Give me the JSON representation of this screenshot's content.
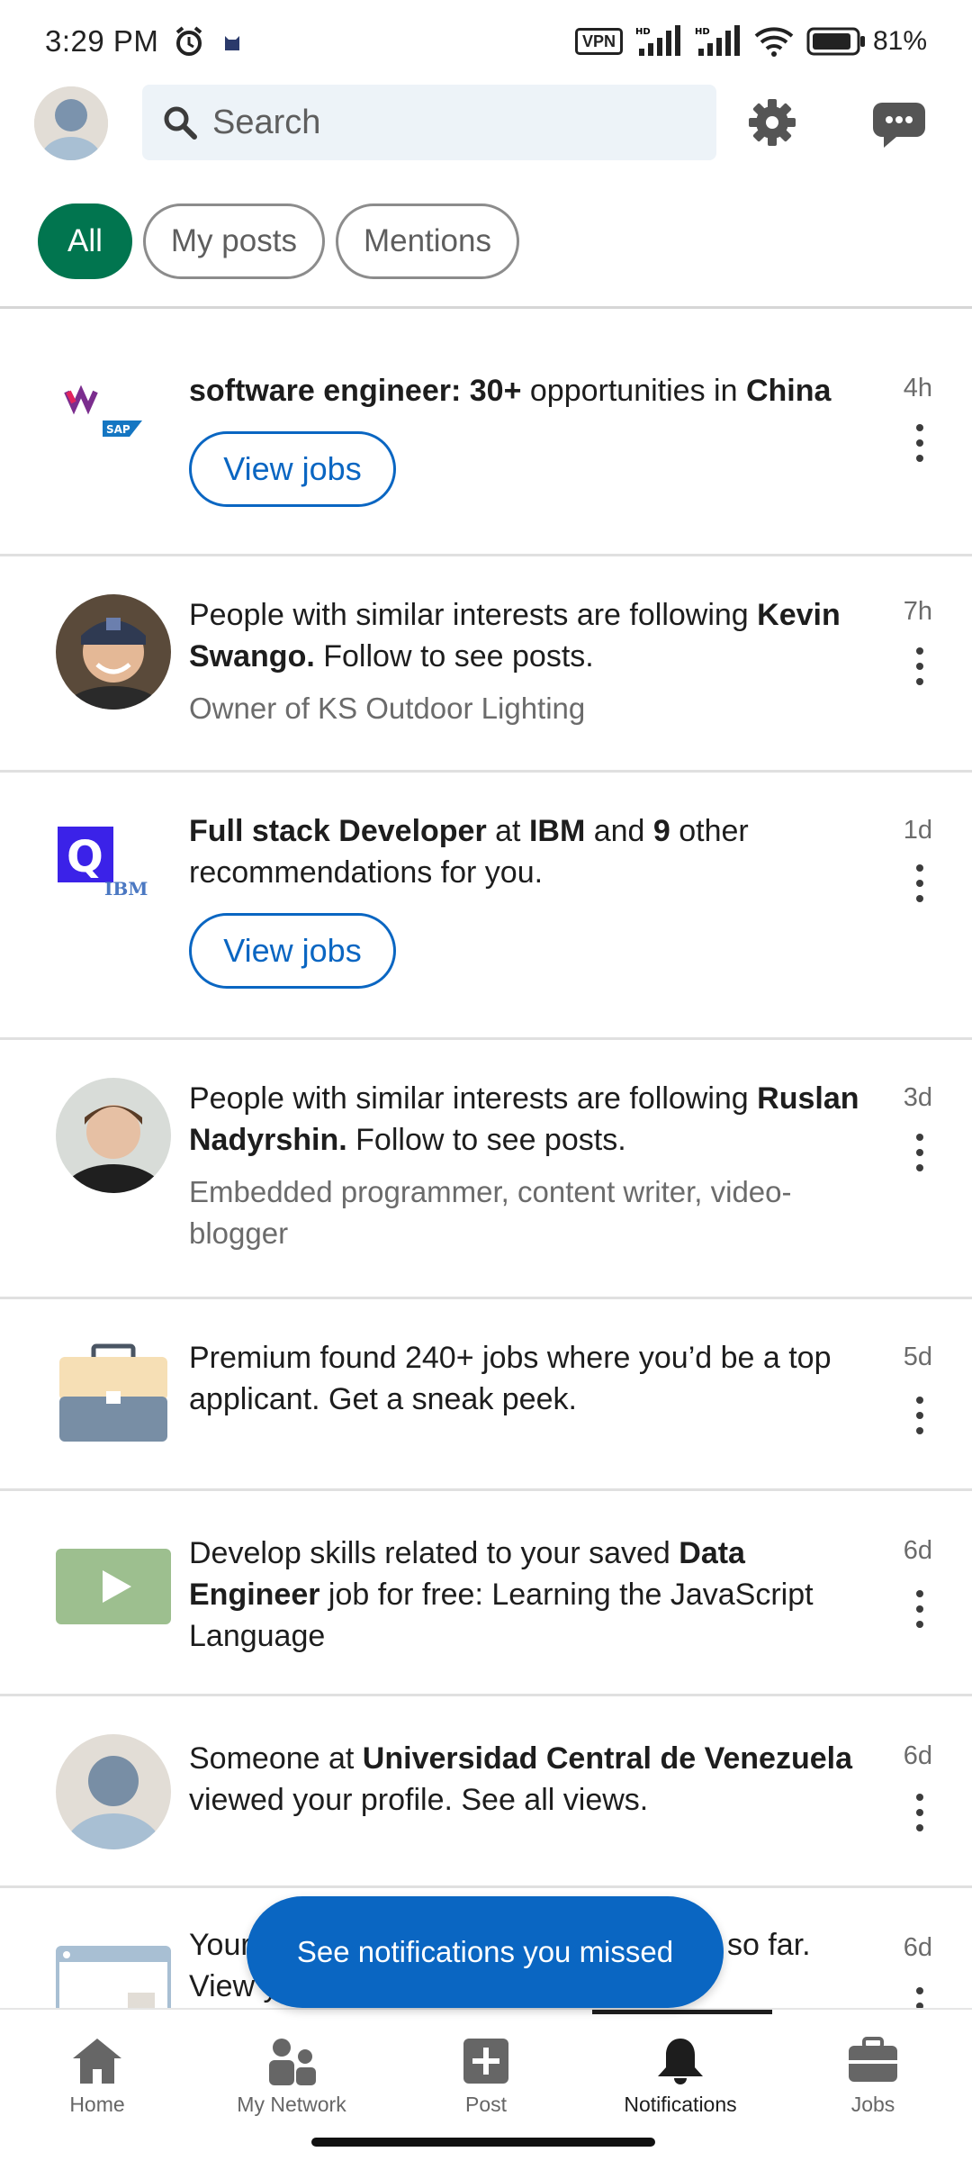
{
  "status_bar": {
    "time": "3:29 PM",
    "vpn": "VPN",
    "battery": "81%"
  },
  "header": {
    "search_placeholder": "Search"
  },
  "filters": [
    {
      "label": "All",
      "active": true
    },
    {
      "label": "My posts",
      "active": false
    },
    {
      "label": "Mentions",
      "active": false
    }
  ],
  "notifications": [
    {
      "icon": "company-logos-sap",
      "parts": [
        {
          "t": "software engineer: ",
          "b": true
        },
        {
          "t": "30+",
          "b": true
        },
        {
          "t": " opportunities in ",
          "b": false
        },
        {
          "t": "China",
          "b": true
        }
      ],
      "button": "View jobs",
      "time": "4h"
    },
    {
      "icon": "person-avatar",
      "parts": [
        {
          "t": "People with similar interests are following ",
          "b": false
        },
        {
          "t": "Kevin Swango.",
          "b": true
        },
        {
          "t": " Follow to see posts.",
          "b": false
        }
      ],
      "subtitle": "Owner of KS Outdoor Lighting",
      "time": "7h"
    },
    {
      "icon": "company-logos-ibm",
      "parts": [
        {
          "t": "Full stack Developer",
          "b": true
        },
        {
          "t": " at ",
          "b": false
        },
        {
          "t": "IBM",
          "b": true
        },
        {
          "t": " and ",
          "b": false
        },
        {
          "t": "9",
          "b": true
        },
        {
          "t": " other recommendations for you.",
          "b": false
        }
      ],
      "button": "View jobs",
      "time": "1d"
    },
    {
      "icon": "person-avatar",
      "parts": [
        {
          "t": "People with similar interests are following ",
          "b": false
        },
        {
          "t": "Ruslan Nadyrshin.",
          "b": true
        },
        {
          "t": " Follow to see posts.",
          "b": false
        }
      ],
      "subtitle": "Embedded programmer, content writer, video-blogger",
      "time": "3d"
    },
    {
      "icon": "briefcase-icon",
      "parts": [
        {
          "t": "Premium found 240+ jobs where you’d be a top applicant. Get a sneak peek.",
          "b": false
        }
      ],
      "time": "5d"
    },
    {
      "icon": "video-play-icon",
      "parts": [
        {
          "t": "Develop skills related to your saved ",
          "b": false
        },
        {
          "t": "Data Engineer",
          "b": true
        },
        {
          "t": " job for free: Learning the JavaScript Language",
          "b": false
        }
      ],
      "time": "6d"
    },
    {
      "icon": "default-avatar",
      "parts": [
        {
          "t": "Someone at ",
          "b": false
        },
        {
          "t": "Universidad Central de Venezuela",
          "b": true
        },
        {
          "t": " viewed your profile. See all views.",
          "b": false
        }
      ],
      "time": "6d"
    },
    {
      "icon": "analytics-icon",
      "parts": [
        {
          "t": "Your",
          "b": false
        }
      ],
      "line2": "View y",
      "tail": "so far.",
      "time": "6d"
    }
  ],
  "missed_button": "See notifications you missed",
  "bottom_nav": [
    {
      "label": "Home",
      "icon": "home-icon",
      "active": false
    },
    {
      "label": "My Network",
      "icon": "network-icon",
      "active": false
    },
    {
      "label": "Post",
      "icon": "post-icon",
      "active": false
    },
    {
      "label": "Notifications",
      "icon": "bell-icon",
      "active": true
    },
    {
      "label": "Jobs",
      "icon": "briefcase-icon",
      "active": false
    }
  ],
  "colors": {
    "accent_green": "#01754f",
    "link_blue": "#0a66c2",
    "search_bg": "#edf3f8"
  }
}
